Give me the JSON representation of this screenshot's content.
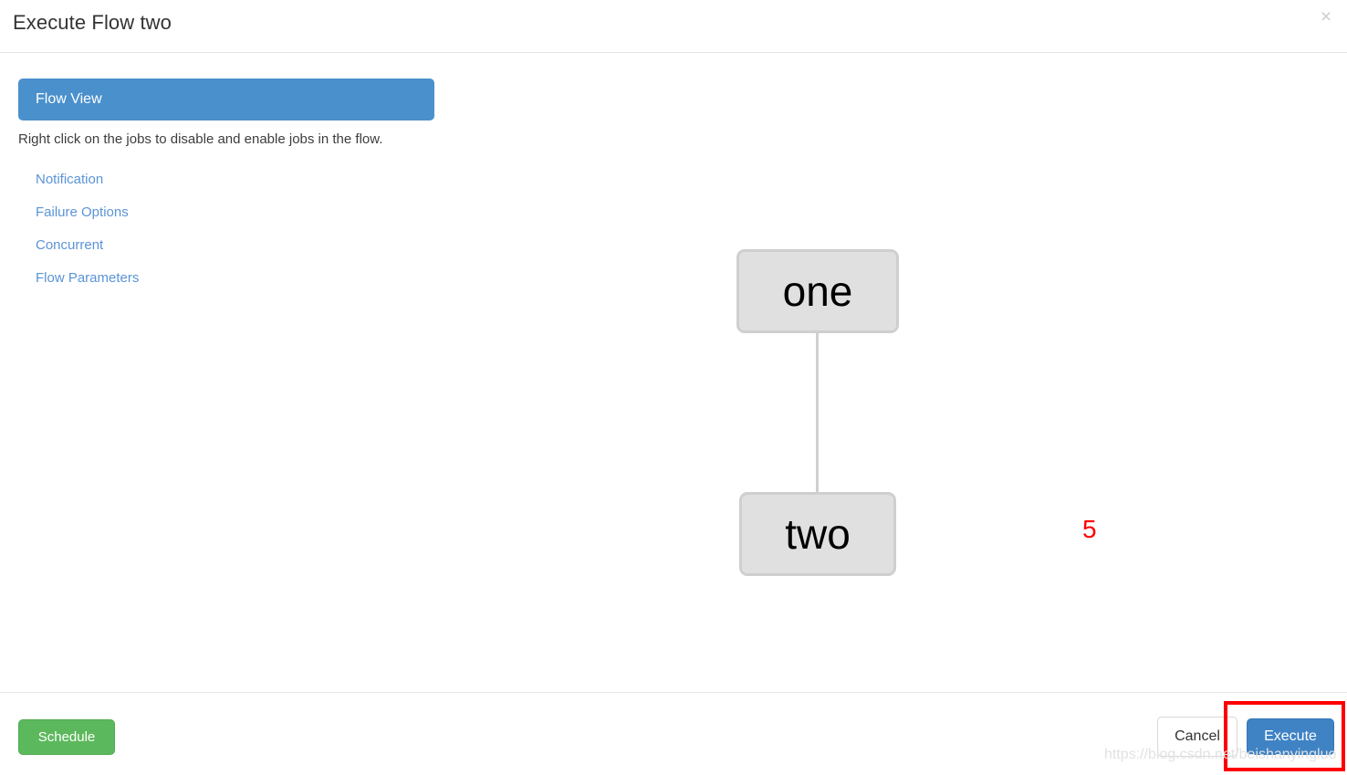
{
  "modal": {
    "title": "Execute Flow two",
    "close_icon_label": "×"
  },
  "side_panel": {
    "tab_label": "Flow View",
    "description": "Right click on the jobs to disable and enable jobs in the flow.",
    "links": [
      {
        "label": "Notification"
      },
      {
        "label": "Failure Options"
      },
      {
        "label": "Concurrent"
      },
      {
        "label": "Flow Parameters"
      }
    ]
  },
  "flow_graph": {
    "nodes": [
      {
        "id": "one",
        "label": "one"
      },
      {
        "id": "two",
        "label": "two"
      }
    ],
    "edges": [
      {
        "from": "one",
        "to": "two"
      }
    ]
  },
  "annotations": {
    "step_number": "5",
    "highlight_target": "execute-button",
    "highlight_color": "#ff0000"
  },
  "footer": {
    "schedule_label": "Schedule",
    "cancel_label": "Cancel",
    "execute_label": "Execute"
  },
  "watermark": {
    "text": "https://blog.csdn.net/beishanyingluo"
  },
  "colors": {
    "tab_blue": "#4a90cc",
    "link_blue": "#5b94d6",
    "schedule_green": "#5cb85c",
    "execute_blue": "#3f83c5",
    "node_fill": "#e0e0e0",
    "node_border": "#cfcfcf"
  }
}
